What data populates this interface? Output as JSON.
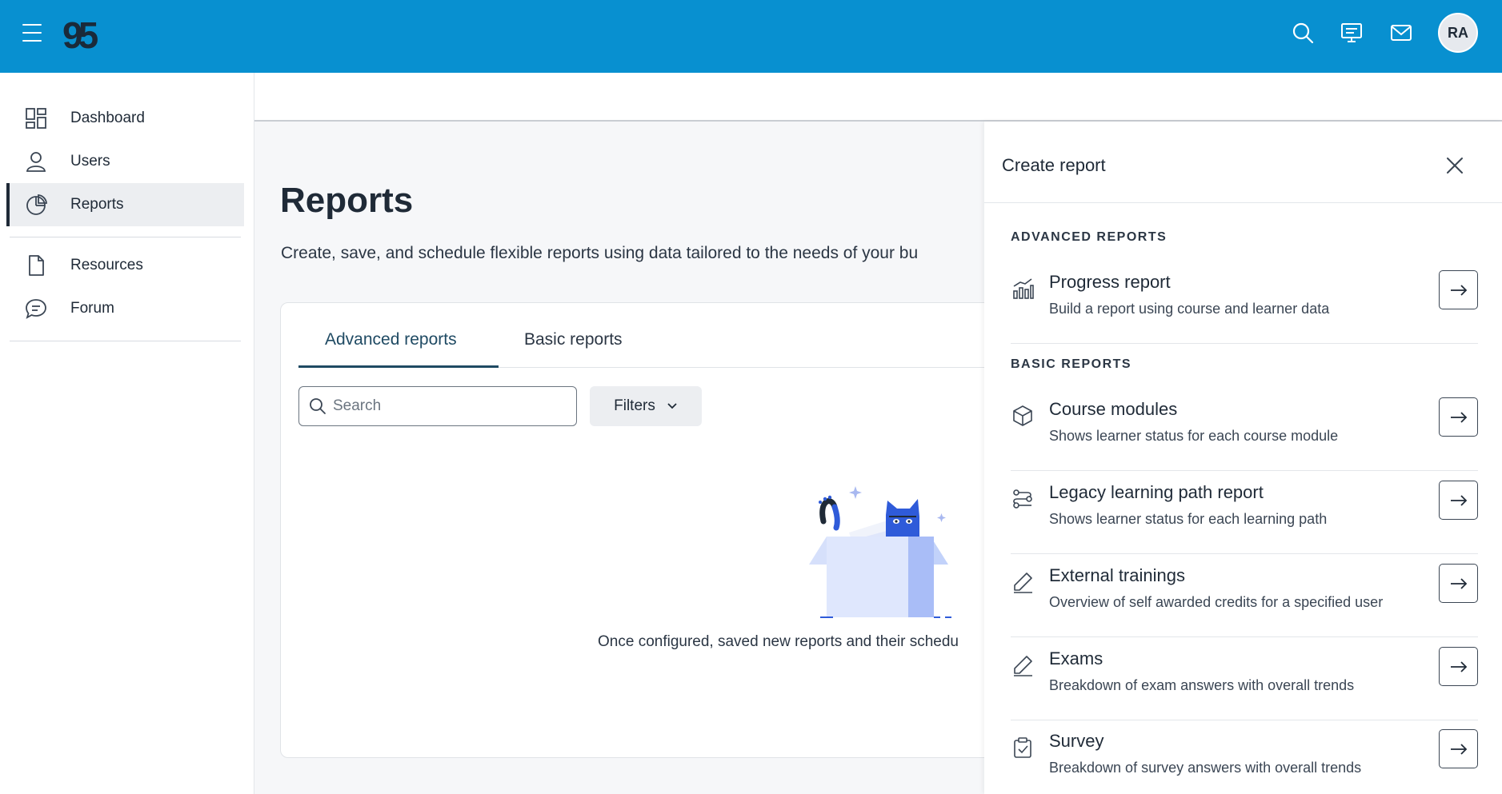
{
  "topbar": {
    "logo_text": "95",
    "avatar_initials": "RA",
    "icons": [
      "menu-icon",
      "search-icon",
      "presentation-icon",
      "mail-icon"
    ]
  },
  "sidebar": {
    "items": [
      {
        "label": "Dashboard",
        "icon": "dashboard-icon"
      },
      {
        "label": "Users",
        "icon": "user-icon"
      },
      {
        "label": "Reports",
        "icon": "pie-chart-icon",
        "active": true
      },
      {
        "label": "Resources",
        "icon": "document-icon"
      },
      {
        "label": "Forum",
        "icon": "chat-icon"
      }
    ]
  },
  "main": {
    "title": "Reports",
    "description": "Create, save, and schedule flexible reports using data tailored to the needs of your bu",
    "tabs": [
      {
        "label": "Advanced reports",
        "active": true
      },
      {
        "label": "Basic reports"
      }
    ],
    "search": {
      "placeholder": "Search",
      "value": ""
    },
    "filters_label": "Filters",
    "empty_text": "Once configured, saved new reports and their schedu"
  },
  "drawer": {
    "title": "Create report",
    "sections": [
      {
        "label": "ADVANCED REPORTS",
        "items": [
          {
            "title": "Progress report",
            "description": "Build a report using course and learner data",
            "icon": "bar-chart-icon"
          }
        ]
      },
      {
        "label": "BASIC REPORTS",
        "items": [
          {
            "title": "Course modules",
            "description": "Shows learner status for each course module",
            "icon": "cube-icon"
          },
          {
            "title": "Legacy learning path report",
            "description": "Shows learner status for each learning path",
            "icon": "path-icon"
          },
          {
            "title": "External trainings",
            "description": "Overview of self awarded credits for a specified user",
            "icon": "pencil-icon"
          },
          {
            "title": "Exams",
            "description": "Breakdown of exam answers with overall trends",
            "icon": "pencil-icon"
          },
          {
            "title": "Survey",
            "description": "Breakdown of survey answers with overall trends",
            "icon": "clipboard-check-icon"
          }
        ]
      }
    ]
  },
  "colors": {
    "topbar": "#0890d0",
    "active_tab": "#1f4a63",
    "illustration_blue": "#2f5bd9"
  }
}
